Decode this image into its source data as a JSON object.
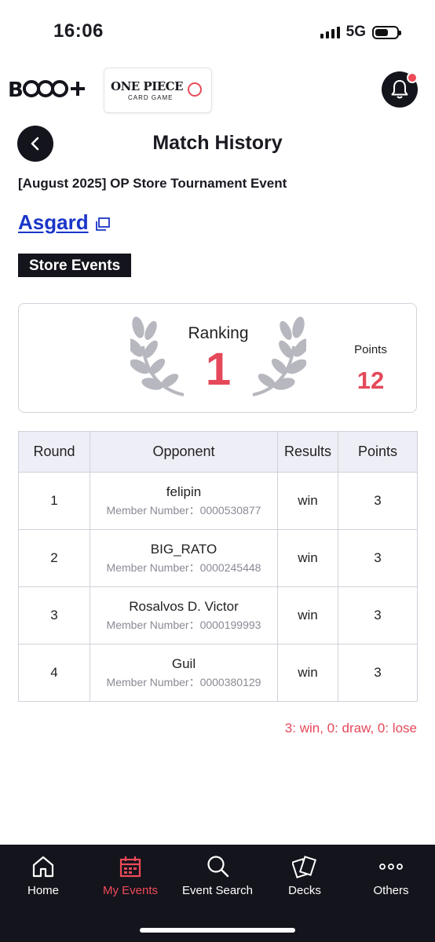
{
  "status_bar": {
    "time": "16:06",
    "network": "5G",
    "battery_level": 0.6
  },
  "header": {
    "app_logo": "B•CG+",
    "game_logo_main": "ONE PIECE",
    "game_logo_sub": "CARD GAME",
    "notification_dot_color": "#ef4a58"
  },
  "page": {
    "title": "Match History",
    "event_name": "[August 2025] OP Store Tournament Event",
    "store_name": "Asgard",
    "badge": "Store Events"
  },
  "ranking": {
    "label": "Ranking",
    "value": "1",
    "points_label": "Points",
    "points_value": "12"
  },
  "table": {
    "headers": [
      "Round",
      "Opponent",
      "Results",
      "Points"
    ],
    "rows": [
      {
        "round": "1",
        "opponent": "felipin",
        "member": "Member Number：0000530877",
        "result": "win",
        "points": "3"
      },
      {
        "round": "2",
        "opponent": "BIG_RATO",
        "member": "Member Number：0000245448",
        "result": "win",
        "points": "3"
      },
      {
        "round": "3",
        "opponent": "Rosalvos D. Victor",
        "member": "Member Number：0000199993",
        "result": "win",
        "points": "3"
      },
      {
        "round": "4",
        "opponent": "Guil",
        "member": "Member Number：0000380129",
        "result": "win",
        "points": "3"
      }
    ]
  },
  "legend_note": "3: win, 0: draw, 0: lose",
  "nav": {
    "items": [
      {
        "label": "Home",
        "icon": "home-icon"
      },
      {
        "label": "My Events",
        "icon": "calendar-icon",
        "active": true
      },
      {
        "label": "Event Search",
        "icon": "search-icon"
      },
      {
        "label": "Decks",
        "icon": "cards-icon"
      },
      {
        "label": "Others",
        "icon": "more-icon"
      }
    ]
  },
  "colors": {
    "accent": "#e5485a",
    "dark": "#14141c",
    "link": "#1a35c9"
  }
}
